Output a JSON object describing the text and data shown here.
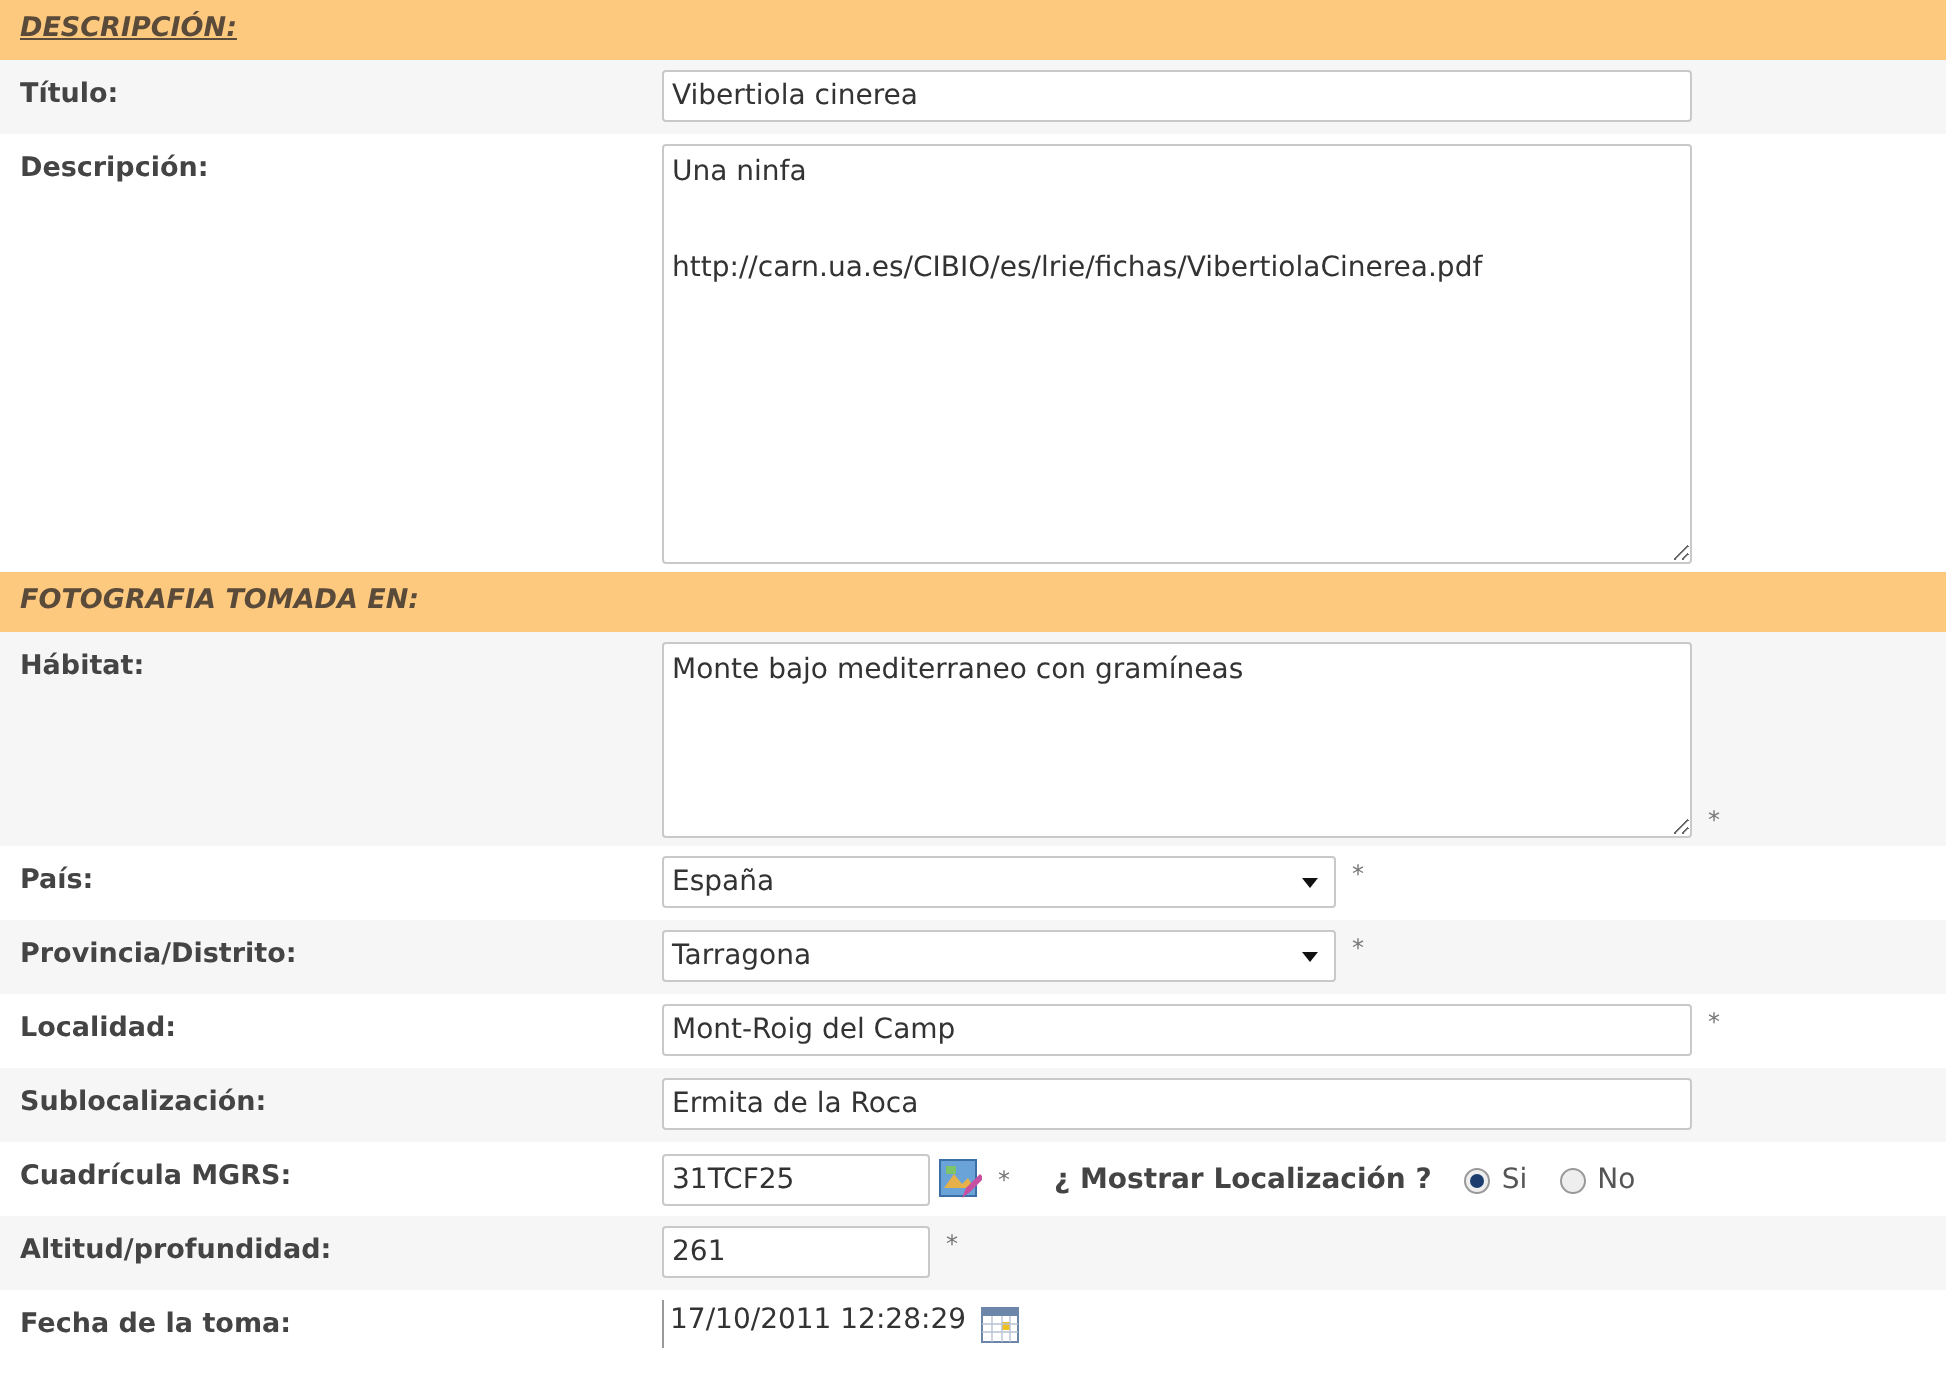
{
  "sections": [
    {
      "title": "DESCRIPCIÓN:",
      "underlined": true,
      "fields": [
        {
          "kind": "text",
          "label": "Título:",
          "value": "Vibertiola cinerea"
        },
        {
          "kind": "textarea",
          "label": "Descripción:",
          "value": "Una ninfa\n\nhttp://carn.ua.es/CIBIO/es/lrie/fichas/VibertiolaCinerea.pdf"
        }
      ]
    },
    {
      "title": "FOTOGRAFIA TOMADA EN:",
      "underlined": false,
      "fields": [
        {
          "kind": "textarea",
          "label": "Hábitat:",
          "value": "Monte bajo mediterraneo con gramíneas",
          "required_mark": "*"
        },
        {
          "kind": "select",
          "label": "País:",
          "value": "España",
          "required_mark": "*"
        },
        {
          "kind": "select",
          "label": "Provincia/Distrito:",
          "value": "Tarragona",
          "required_mark": "*"
        },
        {
          "kind": "text",
          "label": "Localidad:",
          "value": "Mont-Roig del Camp",
          "required_mark": "*"
        },
        {
          "kind": "text",
          "label": "Sublocalización:",
          "value": "Ermita de la Roca"
        },
        {
          "kind": "mgrs",
          "label": "Cuadrícula MGRS:",
          "value": "31TCF25",
          "required_mark": "*",
          "question": "¿ Mostrar Localización ?",
          "options": [
            {
              "label": "Si",
              "selected": true
            },
            {
              "label": "No",
              "selected": false
            }
          ]
        },
        {
          "kind": "short",
          "label": "Altitud/profundidad:",
          "value": "261",
          "required_mark": "*"
        },
        {
          "kind": "date",
          "label": "Fecha de la toma:",
          "value": "17/10/2011 12:28:29"
        }
      ]
    }
  ]
}
